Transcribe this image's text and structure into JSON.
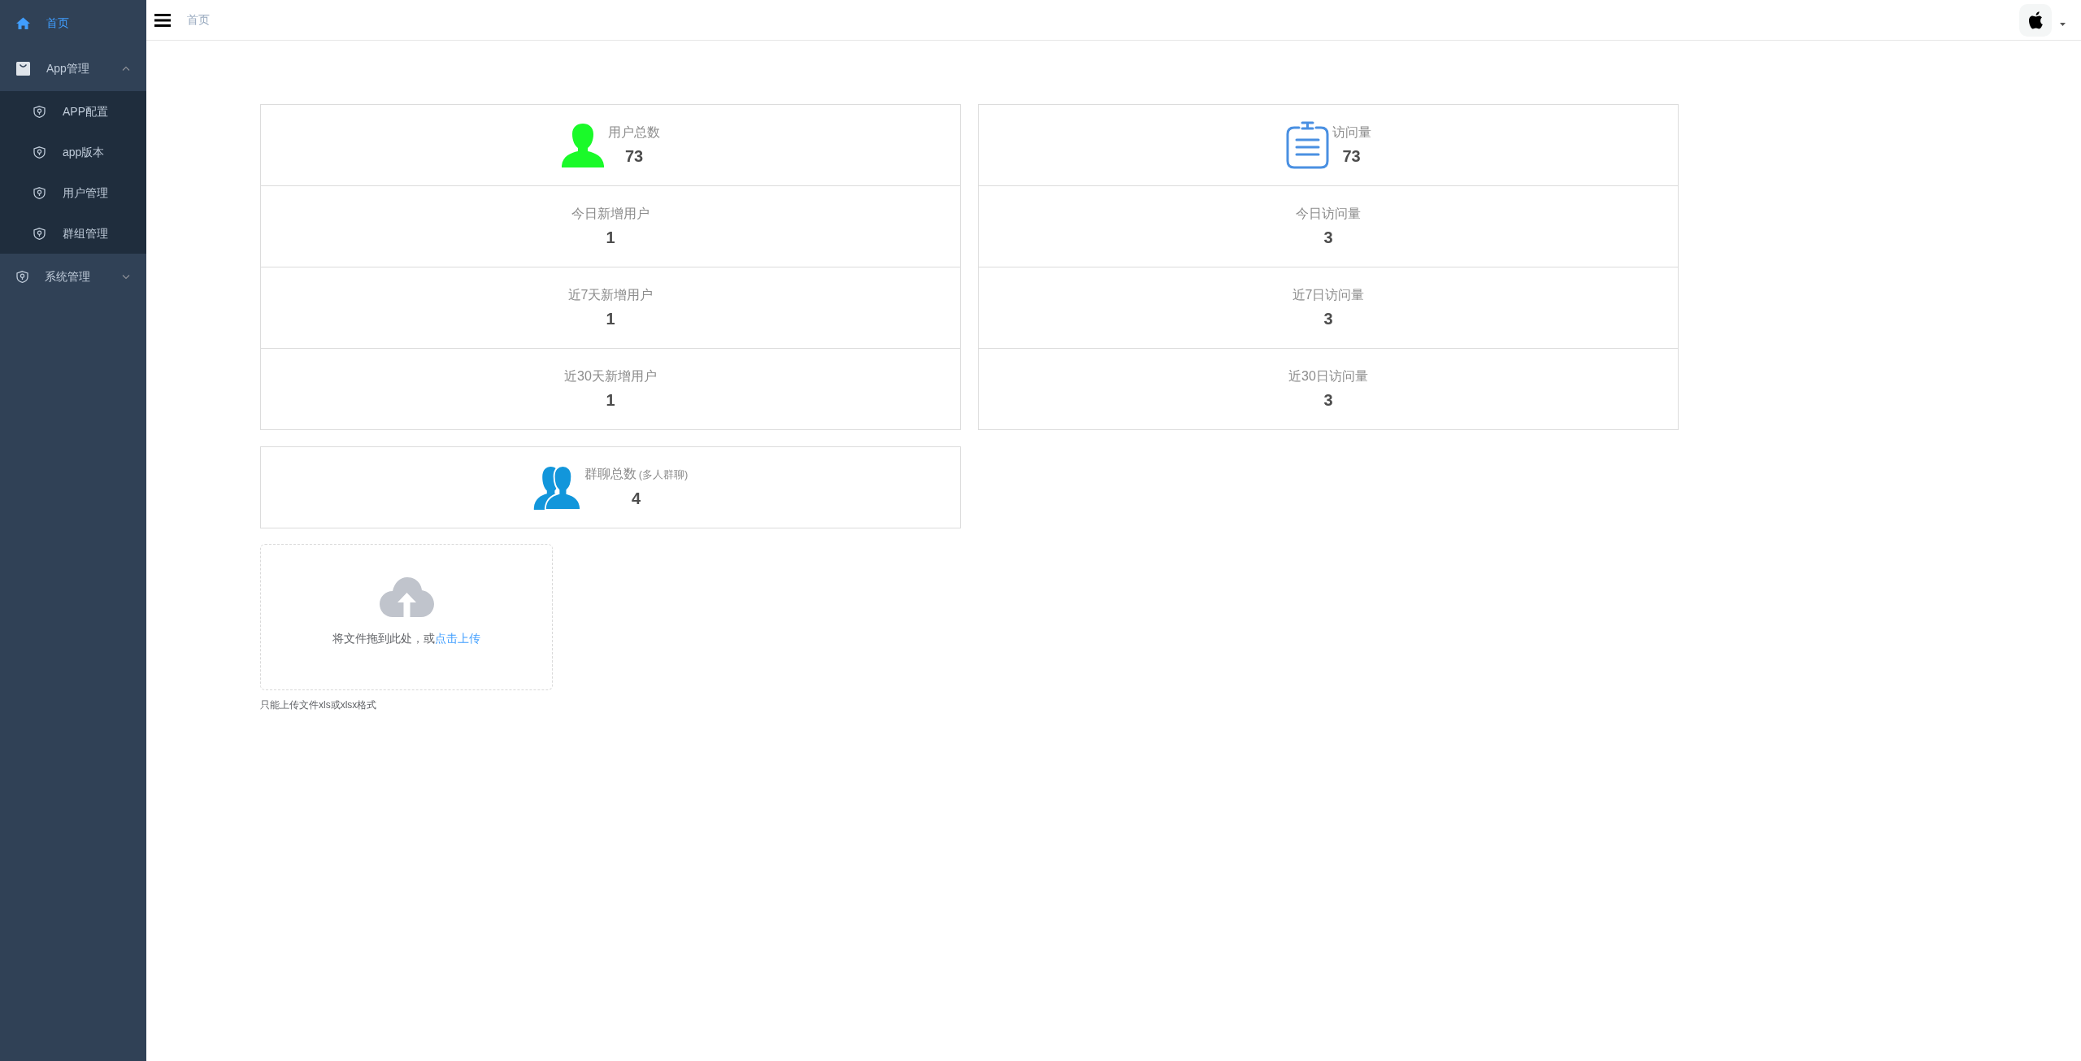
{
  "sidebar": {
    "items": [
      {
        "label": "首页",
        "kind": "link",
        "selected": true
      },
      {
        "label": "App管理",
        "kind": "submenu",
        "selected": false,
        "expanded": true,
        "children": [
          {
            "label": "APP配置",
            "selected": false
          },
          {
            "label": "app版本",
            "selected": false
          },
          {
            "label": "用户管理",
            "selected": false
          },
          {
            "label": "群组管理",
            "selected": false
          }
        ]
      },
      {
        "label": "系统管理",
        "kind": "submenu",
        "selected": false,
        "expanded": false
      }
    ]
  },
  "topbar": {
    "breadcrumb": [
      "首页"
    ]
  },
  "stat_panels": [
    {
      "rows": [
        {
          "kind": "headline",
          "label": "用户总数",
          "value": "73"
        },
        {
          "kind": "plain",
          "label": "今日新增用户",
          "value": "1"
        },
        {
          "kind": "plain",
          "label": "近7天新增用户",
          "value": "1"
        },
        {
          "kind": "plain",
          "label": "近30天新增用户",
          "value": "1"
        }
      ]
    },
    {
      "rows": [
        {
          "kind": "headline",
          "label": "访问量",
          "value": "73"
        },
        {
          "kind": "plain",
          "label": "今日访问量",
          "value": "3"
        },
        {
          "kind": "plain",
          "label": "近7日访问量",
          "value": "3"
        },
        {
          "kind": "plain",
          "label": "近30日访问量",
          "value": "3"
        }
      ]
    }
  ],
  "group_panel": {
    "label": "群聊总数",
    "note": "(多人群聊)",
    "value": "4"
  },
  "upload": {
    "text": "将文件拖到此处，或",
    "link": "点击上传",
    "hint": "只能上传文件xls或xlsx格式"
  }
}
